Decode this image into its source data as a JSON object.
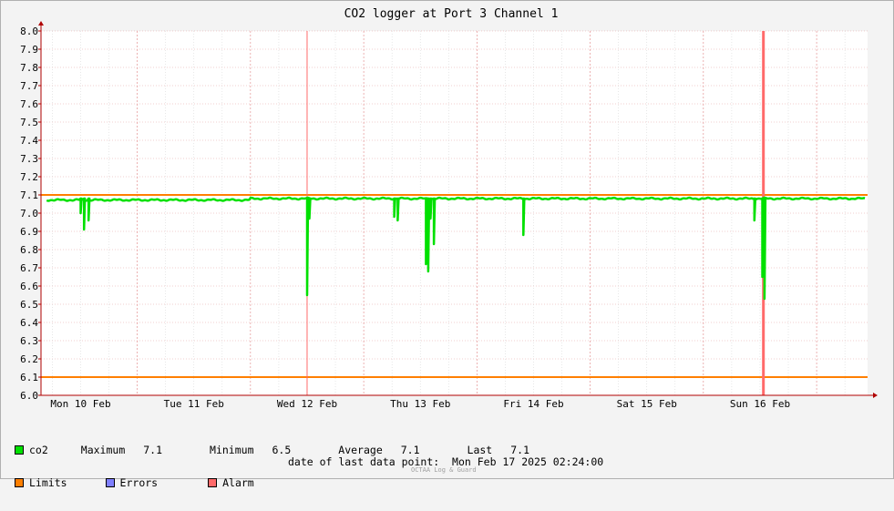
{
  "chart_data": {
    "type": "line",
    "title": "CO2 logger at Port 3 Channel 1",
    "ylim": [
      6.0,
      8.0
    ],
    "y_ticks": [
      "6.0",
      "6.1",
      "6.2",
      "6.3",
      "6.4",
      "6.5",
      "6.6",
      "6.7",
      "6.8",
      "6.9",
      "7.0",
      "7.1",
      "7.2",
      "7.3",
      "7.4",
      "7.5",
      "7.6",
      "7.7",
      "7.8",
      "7.9",
      "8.0"
    ],
    "x_range_days": [
      9.65,
      16.95
    ],
    "x_tick_labels": [
      "Mon 10 Feb",
      "Tue 11 Feb",
      "Wed 12 Feb",
      "Thu 13 Feb",
      "Fri 14 Feb",
      "Sat 15 Feb",
      "Sun 16 Feb"
    ],
    "x_tick_days": [
      10,
      11,
      12,
      13,
      14,
      15,
      16
    ],
    "grid": true,
    "series": [
      {
        "name": "co2",
        "color": "#00e000",
        "baseline": 7.08,
        "dips_day_value": [
          [
            10.0,
            7.0
          ],
          [
            10.03,
            6.91
          ],
          [
            10.07,
            6.96
          ],
          [
            12.0,
            6.55
          ],
          [
            12.02,
            6.97
          ],
          [
            12.77,
            6.98
          ],
          [
            12.8,
            6.96
          ],
          [
            13.05,
            6.72
          ],
          [
            13.07,
            6.68
          ],
          [
            13.09,
            6.97
          ],
          [
            13.12,
            6.83
          ],
          [
            13.91,
            6.88
          ],
          [
            15.95,
            6.96
          ],
          [
            16.02,
            6.65
          ],
          [
            16.04,
            6.53
          ]
        ]
      }
    ],
    "limits": {
      "name": "Limits",
      "color": "#ff7f00",
      "upper": 7.1,
      "lower": 6.1
    },
    "alarms": {
      "name": "Alarm",
      "color": "#ff6a6a",
      "days": [
        12.0,
        16.03
      ]
    },
    "errors": {
      "name": "Errors",
      "color": "#7f7fff"
    }
  },
  "legend": {
    "co2_label": "co2",
    "maximum_label": "Maximum",
    "maximum_value": "7.1",
    "minimum_label": "Minimum",
    "minimum_value": "6.5",
    "average_label": "Average",
    "average_value": "7.1",
    "last_label": "Last",
    "last_value": "7.1",
    "limits_label": "Limits",
    "errors_label": "Errors",
    "alarm_label": "Alarm"
  },
  "footer": {
    "last_data_point_label": "date of last data point:",
    "last_data_point_value": "Mon Feb 17 2025 02:24:00",
    "credit": "OCTAA Log & Guard"
  }
}
